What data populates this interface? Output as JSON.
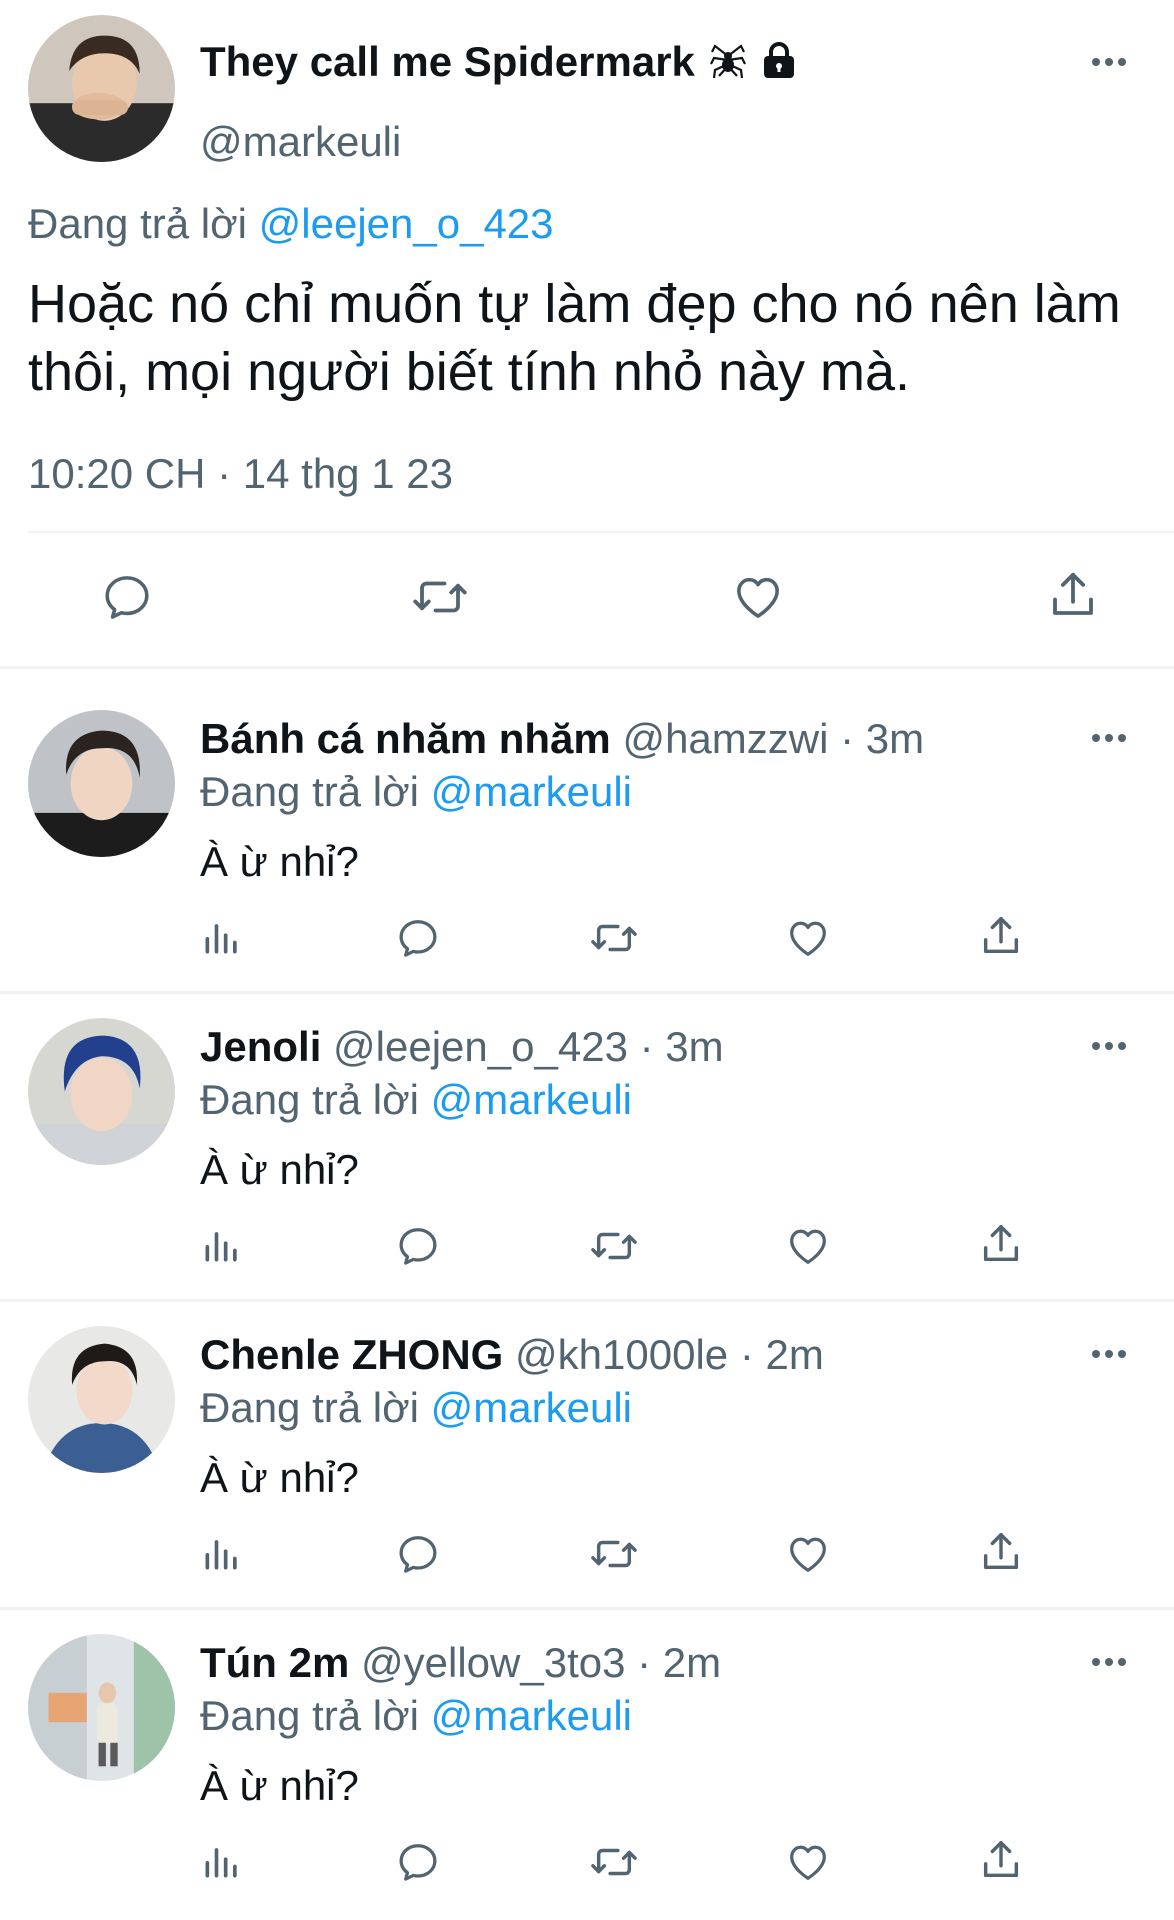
{
  "main_tweet": {
    "display_name": "They call me Spidermark",
    "badges": [
      "spider-emoji",
      "lock-icon"
    ],
    "handle": "@markeuli",
    "replying_label": "Đang trả lời",
    "replying_to": "@leejen_o_423",
    "text": "Hoặc nó chỉ muốn tự làm đẹp cho nó nên làm thôi, mọi người biết tính nhỏ này mà.",
    "timestamp": "10:20 CH · 14 thg 1 23",
    "actions": [
      "reply-icon",
      "retweet-icon",
      "like-icon",
      "share-icon"
    ]
  },
  "replies": [
    {
      "display_name": "Bánh cá nhăm nhăm",
      "handle": "@hamzzwi",
      "time": "· 3m",
      "replying_label": "Đang trả lời",
      "replying_to": "@markeuli",
      "text": "À ừ nhỉ?"
    },
    {
      "display_name": "Jenoli",
      "handle": "@leejen_o_423",
      "time": "· 3m",
      "replying_label": "Đang trả lời",
      "replying_to": "@markeuli",
      "text": "À ừ nhỉ?"
    },
    {
      "display_name": "Chenle ZHONG",
      "handle": "@kh1000le",
      "time": "· 2m",
      "replying_label": "Đang trả lời",
      "replying_to": "@markeuli",
      "text": "À ừ nhỉ?"
    },
    {
      "display_name": "Tún 2m",
      "handle": "@yellow_3to3",
      "time": "· 2m",
      "replying_label": "Đang trả lời",
      "replying_to": "@markeuli",
      "text": "À ừ nhỉ?"
    }
  ],
  "reply_actions": [
    "analytics-icon",
    "reply-icon",
    "retweet-icon",
    "like-icon",
    "share-icon"
  ],
  "colors": {
    "text_primary": "#0f1419",
    "text_secondary": "#536471",
    "link": "#1d9bf0",
    "divider": "#eff3f4"
  }
}
